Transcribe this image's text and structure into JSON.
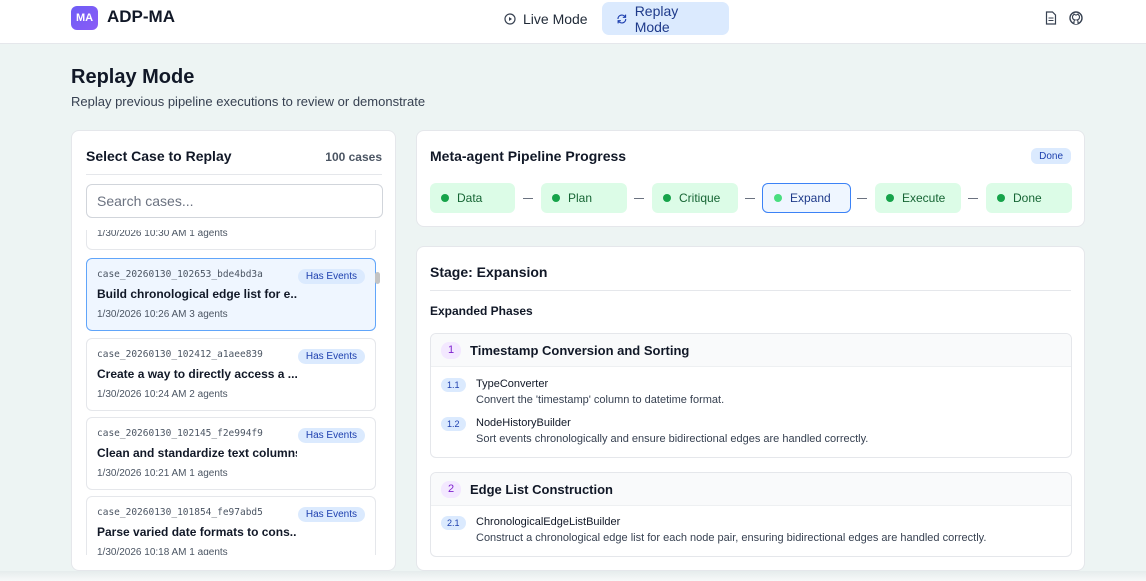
{
  "app": {
    "logo": "MA",
    "title": "ADP-MA"
  },
  "nav": {
    "live_label": "Live Mode",
    "replay_label": "Replay Mode",
    "live_icon": "play-circle-icon",
    "replay_icon": "refresh-icon"
  },
  "header_icons": [
    "document-icon",
    "github-icon"
  ],
  "page": {
    "title": "Replay Mode",
    "subtitle": "Replay previous pipeline executions to review or demonstrate"
  },
  "case_panel": {
    "title": "Select Case to Replay",
    "count": "100 cases",
    "search_placeholder": "Search cases...",
    "partial_meta": "1/30/2026 10:30 AM   1 agents",
    "cases": [
      {
        "id": "case_20260130_102653_bde4bd3a",
        "badge": "Has Events",
        "title": "Build chronological edge list for e...",
        "meta": "1/30/2026 10:26 AM   3 agents"
      },
      {
        "id": "case_20260130_102412_a1aee839",
        "badge": "Has Events",
        "title": "Create a way to directly access a ...",
        "meta": "1/30/2026 10:24 AM   2 agents"
      },
      {
        "id": "case_20260130_102145_f2e994f9",
        "badge": "Has Events",
        "title": "Clean and standardize text columns",
        "meta": "1/30/2026 10:21 AM   1 agents"
      },
      {
        "id": "case_20260130_101854_fe97abd5",
        "badge": "Has Events",
        "title": "Parse varied date formats to cons...",
        "meta": "1/30/2026 10:18 AM   1 agents"
      }
    ]
  },
  "pipeline": {
    "title": "Meta-agent Pipeline Progress",
    "status": "Done",
    "stages": [
      "Data",
      "Plan",
      "Critique",
      "Expand",
      "Execute",
      "Done"
    ],
    "active_stage": "Expand"
  },
  "detail": {
    "stage_title": "Stage: Expansion",
    "phases_heading": "Expanded Phases",
    "phases": [
      {
        "num": "1",
        "name": "Timestamp Conversion and Sorting",
        "agents": [
          {
            "num": "1.1",
            "name": "TypeConverter",
            "desc": "Convert the 'timestamp' column to datetime format."
          },
          {
            "num": "1.2",
            "name": "NodeHistoryBuilder",
            "desc": "Sort events chronologically and ensure bidirectional edges are handled correctly."
          }
        ]
      },
      {
        "num": "2",
        "name": "Edge List Construction",
        "agents": [
          {
            "num": "2.1",
            "name": "ChronologicalEdgeListBuilder",
            "desc": "Construct a chronological edge list for each node pair, ensuring bidirectional edges are handled correctly."
          }
        ]
      }
    ]
  },
  "colors": {
    "accent": "#3b82f6",
    "done_stage": "#dcfce7",
    "badge": "#dbeafe",
    "background": "#edf4f3"
  }
}
